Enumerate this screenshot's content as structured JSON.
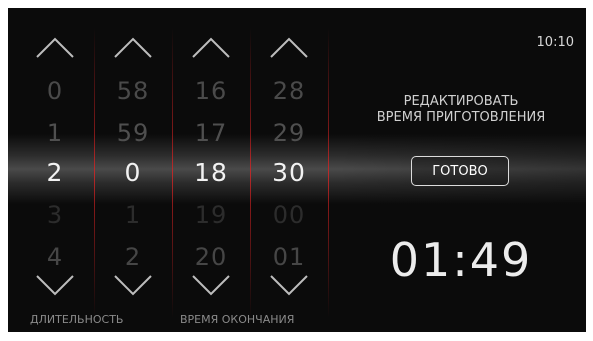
{
  "status": {
    "clock": "10:10"
  },
  "columns": [
    {
      "id": "duration-hours",
      "values": [
        "0",
        "1",
        "2",
        "3",
        "4"
      ]
    },
    {
      "id": "duration-minutes",
      "values": [
        "58",
        "59",
        "0",
        "1",
        "2"
      ]
    },
    {
      "id": "end-hours",
      "values": [
        "16",
        "17",
        "18",
        "19",
        "20"
      ]
    },
    {
      "id": "end-minutes",
      "values": [
        "28",
        "29",
        "30",
        "00",
        "01"
      ]
    }
  ],
  "labels": {
    "duration": "ДЛИТЕЛЬНОСТЬ",
    "end_time": "ВРЕМЯ ОКОНЧАНИЯ"
  },
  "panel": {
    "title_line1": "РЕДАКТИРОВАТЬ",
    "title_line2": "ВРЕМЯ ПРИГОТОВЛЕНИЯ",
    "done_label": "ГОТОВО",
    "cook_time": "01:49"
  },
  "icons": {
    "up": "chevron-up-icon",
    "down": "chevron-down-icon"
  },
  "colors": {
    "background": "#0b0b0b",
    "divider": "#c82828",
    "selected_text": "#f2f2f2",
    "dim_text": "#4a4a4a"
  }
}
